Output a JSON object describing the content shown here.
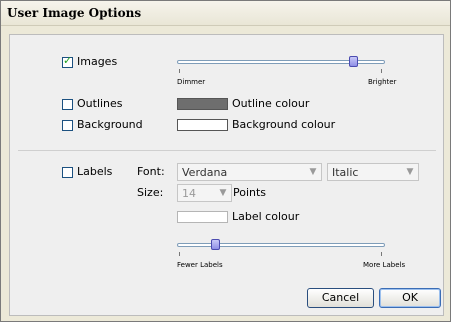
{
  "dialog": {
    "title": "User Image Options"
  },
  "images": {
    "label": "Images",
    "checked": true,
    "slider_left": "Dimmer",
    "slider_right": "Brighter",
    "value": 0.86
  },
  "outlines": {
    "label": "Outlines",
    "checked": false,
    "colour_label": "Outline colour",
    "colour": "#6e6e6e"
  },
  "background": {
    "label": "Background",
    "checked": false,
    "colour_label": "Background colour",
    "colour": "#ffffff"
  },
  "labels": {
    "label": "Labels",
    "checked": false,
    "font_label": "Font:",
    "font_value": "Verdana",
    "style_value": "Italic",
    "size_label": "Size:",
    "size_value": "14",
    "points_label": "Points",
    "colour_label": "Label colour",
    "colour": "#ffffff",
    "slider_left": "Fewer Labels",
    "slider_right": "More Labels",
    "value": 0.17
  },
  "buttons": {
    "cancel": "Cancel",
    "ok": "OK"
  },
  "icons": {
    "dropdown": "chevron-down-icon",
    "check": "check-icon"
  }
}
